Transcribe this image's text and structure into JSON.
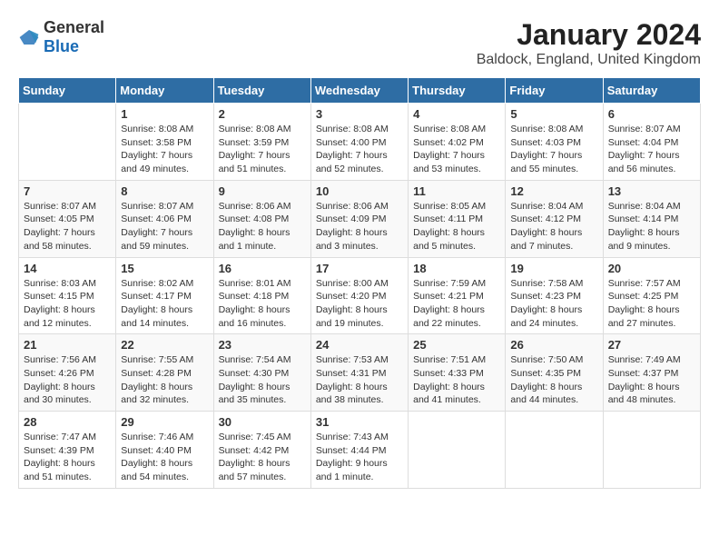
{
  "logo": {
    "general": "General",
    "blue": "Blue"
  },
  "title": "January 2024",
  "subtitle": "Baldock, England, United Kingdom",
  "calendar": {
    "headers": [
      "Sunday",
      "Monday",
      "Tuesday",
      "Wednesday",
      "Thursday",
      "Friday",
      "Saturday"
    ],
    "weeks": [
      [
        {
          "day": "",
          "sunrise": "",
          "sunset": "",
          "daylight": ""
        },
        {
          "day": "1",
          "sunrise": "Sunrise: 8:08 AM",
          "sunset": "Sunset: 3:58 PM",
          "daylight": "Daylight: 7 hours and 49 minutes."
        },
        {
          "day": "2",
          "sunrise": "Sunrise: 8:08 AM",
          "sunset": "Sunset: 3:59 PM",
          "daylight": "Daylight: 7 hours and 51 minutes."
        },
        {
          "day": "3",
          "sunrise": "Sunrise: 8:08 AM",
          "sunset": "Sunset: 4:00 PM",
          "daylight": "Daylight: 7 hours and 52 minutes."
        },
        {
          "day": "4",
          "sunrise": "Sunrise: 8:08 AM",
          "sunset": "Sunset: 4:02 PM",
          "daylight": "Daylight: 7 hours and 53 minutes."
        },
        {
          "day": "5",
          "sunrise": "Sunrise: 8:08 AM",
          "sunset": "Sunset: 4:03 PM",
          "daylight": "Daylight: 7 hours and 55 minutes."
        },
        {
          "day": "6",
          "sunrise": "Sunrise: 8:07 AM",
          "sunset": "Sunset: 4:04 PM",
          "daylight": "Daylight: 7 hours and 56 minutes."
        }
      ],
      [
        {
          "day": "7",
          "sunrise": "Sunrise: 8:07 AM",
          "sunset": "Sunset: 4:05 PM",
          "daylight": "Daylight: 7 hours and 58 minutes."
        },
        {
          "day": "8",
          "sunrise": "Sunrise: 8:07 AM",
          "sunset": "Sunset: 4:06 PM",
          "daylight": "Daylight: 7 hours and 59 minutes."
        },
        {
          "day": "9",
          "sunrise": "Sunrise: 8:06 AM",
          "sunset": "Sunset: 4:08 PM",
          "daylight": "Daylight: 8 hours and 1 minute."
        },
        {
          "day": "10",
          "sunrise": "Sunrise: 8:06 AM",
          "sunset": "Sunset: 4:09 PM",
          "daylight": "Daylight: 8 hours and 3 minutes."
        },
        {
          "day": "11",
          "sunrise": "Sunrise: 8:05 AM",
          "sunset": "Sunset: 4:11 PM",
          "daylight": "Daylight: 8 hours and 5 minutes."
        },
        {
          "day": "12",
          "sunrise": "Sunrise: 8:04 AM",
          "sunset": "Sunset: 4:12 PM",
          "daylight": "Daylight: 8 hours and 7 minutes."
        },
        {
          "day": "13",
          "sunrise": "Sunrise: 8:04 AM",
          "sunset": "Sunset: 4:14 PM",
          "daylight": "Daylight: 8 hours and 9 minutes."
        }
      ],
      [
        {
          "day": "14",
          "sunrise": "Sunrise: 8:03 AM",
          "sunset": "Sunset: 4:15 PM",
          "daylight": "Daylight: 8 hours and 12 minutes."
        },
        {
          "day": "15",
          "sunrise": "Sunrise: 8:02 AM",
          "sunset": "Sunset: 4:17 PM",
          "daylight": "Daylight: 8 hours and 14 minutes."
        },
        {
          "day": "16",
          "sunrise": "Sunrise: 8:01 AM",
          "sunset": "Sunset: 4:18 PM",
          "daylight": "Daylight: 8 hours and 16 minutes."
        },
        {
          "day": "17",
          "sunrise": "Sunrise: 8:00 AM",
          "sunset": "Sunset: 4:20 PM",
          "daylight": "Daylight: 8 hours and 19 minutes."
        },
        {
          "day": "18",
          "sunrise": "Sunrise: 7:59 AM",
          "sunset": "Sunset: 4:21 PM",
          "daylight": "Daylight: 8 hours and 22 minutes."
        },
        {
          "day": "19",
          "sunrise": "Sunrise: 7:58 AM",
          "sunset": "Sunset: 4:23 PM",
          "daylight": "Daylight: 8 hours and 24 minutes."
        },
        {
          "day": "20",
          "sunrise": "Sunrise: 7:57 AM",
          "sunset": "Sunset: 4:25 PM",
          "daylight": "Daylight: 8 hours and 27 minutes."
        }
      ],
      [
        {
          "day": "21",
          "sunrise": "Sunrise: 7:56 AM",
          "sunset": "Sunset: 4:26 PM",
          "daylight": "Daylight: 8 hours and 30 minutes."
        },
        {
          "day": "22",
          "sunrise": "Sunrise: 7:55 AM",
          "sunset": "Sunset: 4:28 PM",
          "daylight": "Daylight: 8 hours and 32 minutes."
        },
        {
          "day": "23",
          "sunrise": "Sunrise: 7:54 AM",
          "sunset": "Sunset: 4:30 PM",
          "daylight": "Daylight: 8 hours and 35 minutes."
        },
        {
          "day": "24",
          "sunrise": "Sunrise: 7:53 AM",
          "sunset": "Sunset: 4:31 PM",
          "daylight": "Daylight: 8 hours and 38 minutes."
        },
        {
          "day": "25",
          "sunrise": "Sunrise: 7:51 AM",
          "sunset": "Sunset: 4:33 PM",
          "daylight": "Daylight: 8 hours and 41 minutes."
        },
        {
          "day": "26",
          "sunrise": "Sunrise: 7:50 AM",
          "sunset": "Sunset: 4:35 PM",
          "daylight": "Daylight: 8 hours and 44 minutes."
        },
        {
          "day": "27",
          "sunrise": "Sunrise: 7:49 AM",
          "sunset": "Sunset: 4:37 PM",
          "daylight": "Daylight: 8 hours and 48 minutes."
        }
      ],
      [
        {
          "day": "28",
          "sunrise": "Sunrise: 7:47 AM",
          "sunset": "Sunset: 4:39 PM",
          "daylight": "Daylight: 8 hours and 51 minutes."
        },
        {
          "day": "29",
          "sunrise": "Sunrise: 7:46 AM",
          "sunset": "Sunset: 4:40 PM",
          "daylight": "Daylight: 8 hours and 54 minutes."
        },
        {
          "day": "30",
          "sunrise": "Sunrise: 7:45 AM",
          "sunset": "Sunset: 4:42 PM",
          "daylight": "Daylight: 8 hours and 57 minutes."
        },
        {
          "day": "31",
          "sunrise": "Sunrise: 7:43 AM",
          "sunset": "Sunset: 4:44 PM",
          "daylight": "Daylight: 9 hours and 1 minute."
        },
        {
          "day": "",
          "sunrise": "",
          "sunset": "",
          "daylight": ""
        },
        {
          "day": "",
          "sunrise": "",
          "sunset": "",
          "daylight": ""
        },
        {
          "day": "",
          "sunrise": "",
          "sunset": "",
          "daylight": ""
        }
      ]
    ]
  }
}
